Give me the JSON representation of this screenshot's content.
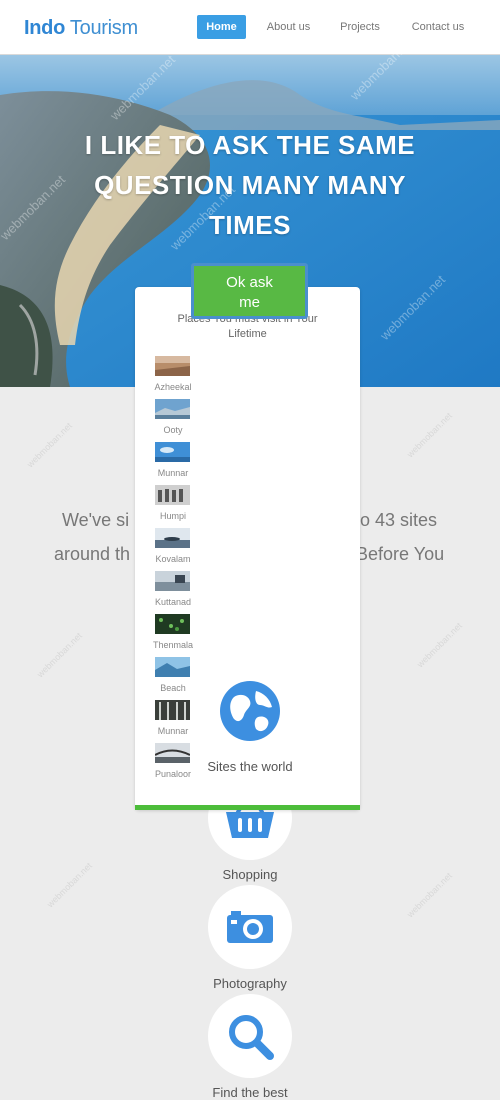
{
  "brand": {
    "bold": "Indo",
    "light": "Tourism"
  },
  "nav": {
    "items": [
      {
        "label": "Home",
        "active": true
      },
      {
        "label": "About us",
        "active": false
      },
      {
        "label": "Projects",
        "active": false
      },
      {
        "label": "Contact us",
        "active": false
      }
    ]
  },
  "hero": {
    "line1": "I LIKE TO ASK THE SAME",
    "line2": "QUESTION MANY MANY",
    "line3": "TIMES",
    "button_line1": "Ok ask",
    "button_line2": "me"
  },
  "popup": {
    "title_line1": "Places You must visit in Your",
    "title_line2": "Lifetime",
    "places": [
      {
        "name": "Azheekal",
        "icon": "beach-thumbnail"
      },
      {
        "name": "Ooty",
        "icon": "hills-thumbnail"
      },
      {
        "name": "Munnar",
        "icon": "sky-thumbnail"
      },
      {
        "name": "Humpi",
        "icon": "ruins-thumbnail"
      },
      {
        "name": "Kovalam",
        "icon": "shore-thumbnail"
      },
      {
        "name": "Kuttanad",
        "icon": "backwaters-thumbnail"
      },
      {
        "name": "Thenmala",
        "icon": "forest-thumbnail"
      },
      {
        "name": "Beach",
        "icon": "sea-thumbnail"
      },
      {
        "name": "Munnar",
        "icon": "trees-thumbnail"
      },
      {
        "name": "Punaloor",
        "icon": "bridge-thumbnail"
      }
    ]
  },
  "stats": {
    "line1_left": "We've si",
    "line1_right": "o 43 sites",
    "line2_left": "around th",
    "line2_right": "Before You"
  },
  "features": [
    {
      "label": "Sites the world",
      "icon": "globe-icon"
    },
    {
      "label": "Shopping",
      "icon": "basket-icon"
    },
    {
      "label": "Photography",
      "icon": "camera-icon"
    },
    {
      "label": "Find the best",
      "icon": "search-icon"
    }
  ],
  "watermark": "webmoban.net",
  "colors": {
    "accent": "#3a9ee4",
    "button": "#58b944",
    "icon": "#3d8fe0",
    "bar": "#4cbd3a"
  }
}
